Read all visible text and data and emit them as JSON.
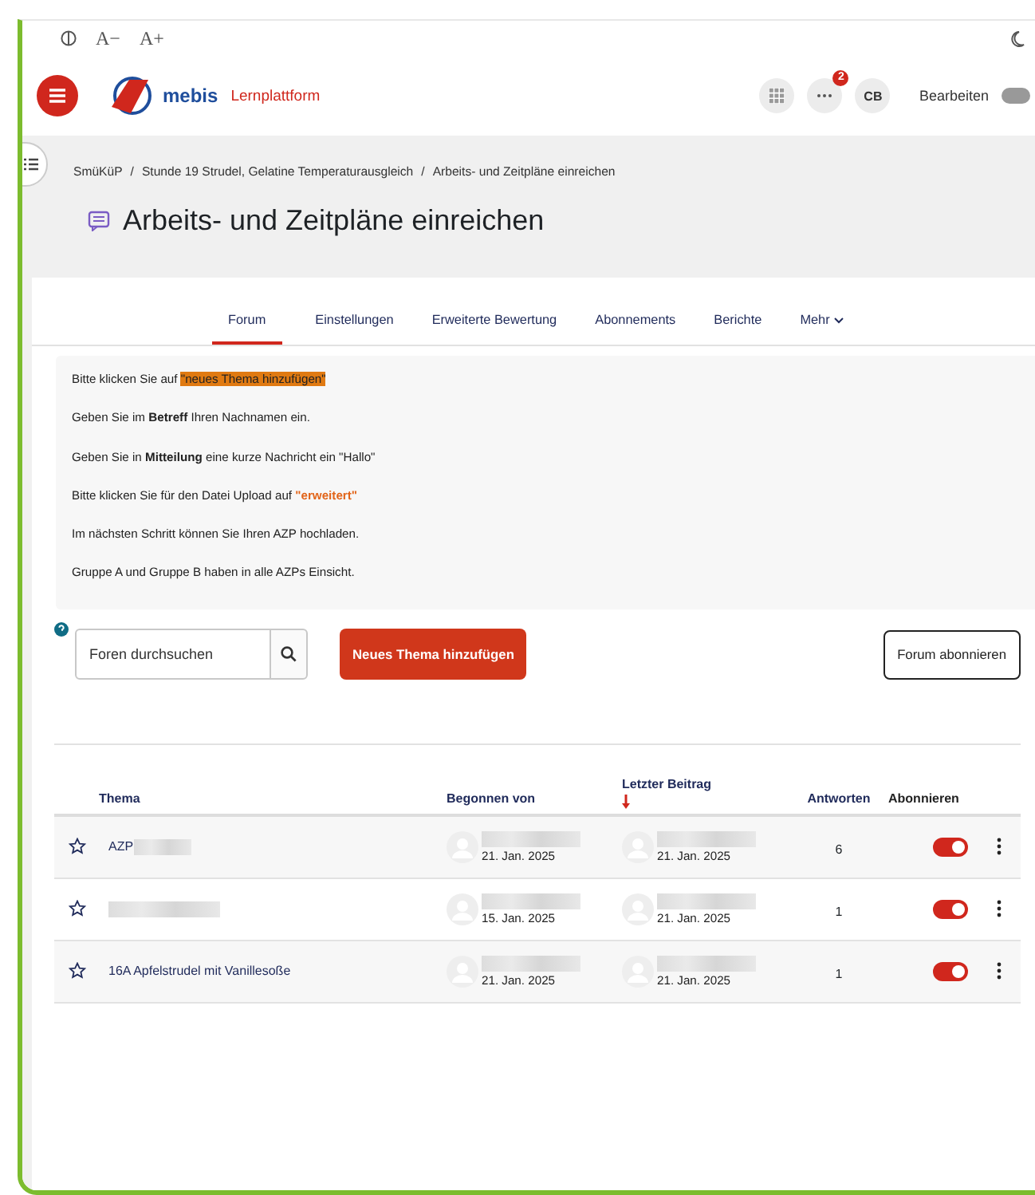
{
  "accessibility_bar": {
    "font_smaller": "A−",
    "font_larger": "A+"
  },
  "header": {
    "brand": "mebis",
    "subtitle": "Lernplattform",
    "notification_count": "2",
    "avatar_initials": "CB",
    "edit_label": "Bearbeiten",
    "edit_mode": false
  },
  "breadcrumb": [
    {
      "label": "SmüKüP"
    },
    {
      "separator": "/",
      "label": "Stunde 19 Strudel, Gelatine Temperaturausgleich"
    },
    {
      "separator": "/",
      "label": "Arbeits- und Zeitpläne einreichen"
    }
  ],
  "page_title": "Arbeits- und Zeitpläne einreichen",
  "tabs": [
    {
      "label": "Forum",
      "selected": true
    },
    {
      "label": "Einstellungen",
      "selected": false
    },
    {
      "label": "Erweiterte Bewertung",
      "selected": false
    },
    {
      "label": "Abonnements",
      "selected": false
    },
    {
      "label": "Berichte",
      "selected": false
    },
    {
      "label": "Mehr",
      "selected": false,
      "kind": "menu"
    }
  ],
  "instructions": [
    {
      "text": "Bitte klicken Sie auf ",
      "highlight": "\"neues Thema hinzufügen\"",
      "kind": "marker"
    },
    {
      "text": "Geben Sie im **Betreff** Ihren Nachnamen ein."
    },
    {
      "text": "Geben Sie in **Mitteilung** eine kurze Nachricht ein \"Hallo\""
    },
    {
      "text": "Bitte klicken Sie für den Datei Upload auf ",
      "highlight": "\"erweitert\"",
      "kind": "colored"
    },
    {
      "text": "Im nächsten Schritt können Sie Ihren AZP hochladen."
    },
    {
      "text": "Gruppe A und Gruppe B haben in alle AZPs Einsicht."
    }
  ],
  "search": {
    "placeholder": "Foren durchsuchen"
  },
  "new_topic_button": "Neues Thema hinzufügen",
  "subscribe_button": "Forum abonnieren",
  "table": {
    "columns": [
      "Thema",
      "Begonnen von",
      "Letzter Beitrag",
      "Antworten",
      "Abonnieren"
    ],
    "rows": [
      {
        "topic": "AZP",
        "topic_redacted": true,
        "started": "21. Jan. 2025",
        "last_post": "21. Jan. 2025",
        "replies": "6",
        "starred": false,
        "subscribed": true
      },
      {
        "topic_redacted": true,
        "started": "15. Jan. 2025",
        "last_post": "21. Jan. 2025",
        "replies": "1",
        "starred": false,
        "subscribed": true
      },
      {
        "topic": "16A Apfelstrudel mit Vanillesoße",
        "topic_redacted": false,
        "started": "21. Jan. 2025",
        "last_post": "21. Jan. 2025",
        "replies": "1",
        "starred": false,
        "subscribed": true
      }
    ]
  }
}
